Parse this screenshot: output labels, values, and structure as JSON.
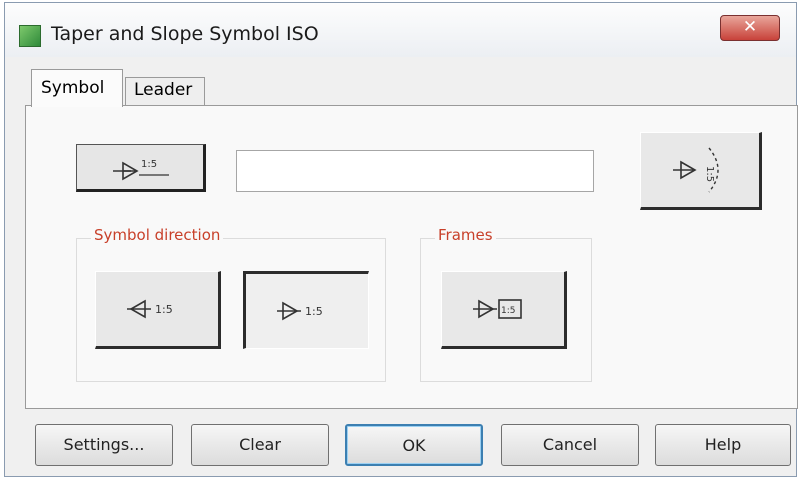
{
  "window": {
    "title": "Taper and Slope Symbol ISO",
    "close_symbol": "✕",
    "icon": "app-icon"
  },
  "tabs": [
    {
      "label": "Symbol",
      "selected": true
    },
    {
      "label": "Leader",
      "selected": false
    }
  ],
  "symbol_tab": {
    "preview_symbol": {
      "ratio": "1:5",
      "icon": "taper-arrow-underlined-icon"
    },
    "value_field": {
      "value": "",
      "placeholder": ""
    },
    "vertical_option": {
      "ratio": "1:5",
      "icon": "taper-vertical-dashed-icon"
    },
    "symbol_direction": {
      "label": "Symbol direction",
      "options": [
        {
          "ratio": "1:5",
          "icon": "taper-left-icon",
          "selected": false
        },
        {
          "ratio": "1:5",
          "icon": "taper-right-icon",
          "selected": true
        }
      ]
    },
    "frames": {
      "label": "Frames",
      "option": {
        "ratio": "1:5",
        "icon": "taper-framed-icon"
      }
    }
  },
  "footer_buttons": [
    {
      "label": "Settings...",
      "mnemonic": "S"
    },
    {
      "label": "Clear",
      "mnemonic": "C"
    },
    {
      "label": "OK",
      "default": true
    },
    {
      "label": "Cancel"
    },
    {
      "label": "Help",
      "mnemonic": "H"
    }
  ],
  "colors": {
    "group_label": "#c8402a",
    "ok_border": "#3c7fb1",
    "close_button": "#c8423a"
  }
}
